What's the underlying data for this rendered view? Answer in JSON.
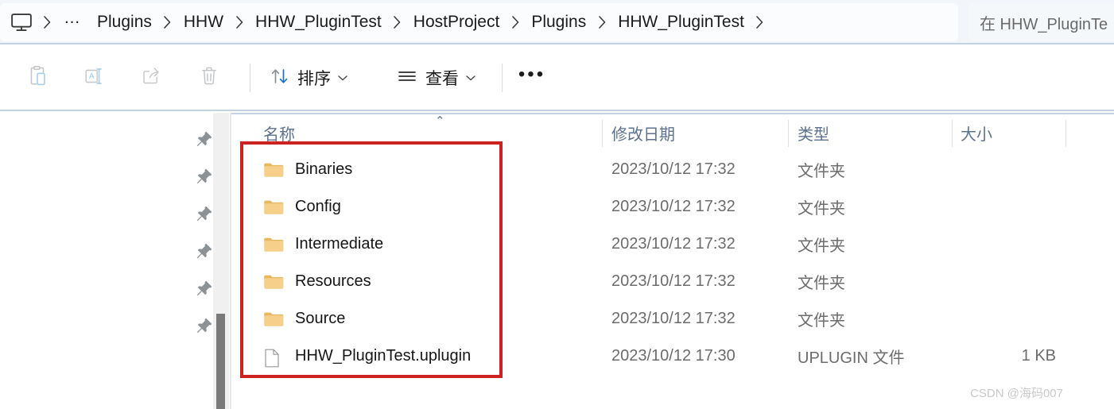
{
  "window": {
    "app": "windows-file-explorer",
    "accent_color": "#0f6cbd",
    "annotation_color": "#cc2222"
  },
  "addressbar": {
    "pc_icon": "monitor-icon",
    "overflow_label": "…",
    "crumbs": [
      "Plugins",
      "HHW",
      "HHW_PluginTest",
      "HostProject",
      "Plugins",
      "HHW_PluginTest"
    ],
    "separator": "›",
    "search": {
      "placeholder": "在 HHW_PluginTe",
      "value": ""
    }
  },
  "toolbar": {
    "icon_buttons": [
      {
        "name": "paste-button",
        "icon": "clipboard-paste-icon",
        "enabled": false
      },
      {
        "name": "rename-button",
        "icon": "rename-icon",
        "enabled": false
      },
      {
        "name": "share-button",
        "icon": "share-icon",
        "enabled": false
      },
      {
        "name": "delete-button",
        "icon": "trash-icon",
        "enabled": false
      }
    ],
    "sort": {
      "label": "排序",
      "icon": "sort-arrows-icon",
      "chevron": "⌄"
    },
    "view": {
      "label": "查看",
      "icon": "view-lines-icon",
      "chevron": "⌄"
    },
    "more": {
      "label": "•••",
      "icon": "more-horizontal-icon"
    }
  },
  "navpane": {
    "pin_icon": "pin-icon",
    "pin_count": 6,
    "scrollbar": "vertical-scrollbar"
  },
  "filelist": {
    "columns": [
      {
        "key": "name",
        "label": "名称",
        "sorted": "asc",
        "sort_caret": "⌃"
      },
      {
        "key": "date",
        "label": "修改日期"
      },
      {
        "key": "type",
        "label": "类型"
      },
      {
        "key": "size",
        "label": "大小"
      }
    ],
    "rows": [
      {
        "name": "Binaries",
        "icon": "folder-icon",
        "date": "2023/10/12 17:32",
        "type": "文件夹",
        "size": ""
      },
      {
        "name": "Config",
        "icon": "folder-icon",
        "date": "2023/10/12 17:32",
        "type": "文件夹",
        "size": ""
      },
      {
        "name": "Intermediate",
        "icon": "folder-icon",
        "date": "2023/10/12 17:32",
        "type": "文件夹",
        "size": ""
      },
      {
        "name": "Resources",
        "icon": "folder-icon",
        "date": "2023/10/12 17:32",
        "type": "文件夹",
        "size": ""
      },
      {
        "name": "Source",
        "icon": "folder-icon",
        "date": "2023/10/12 17:32",
        "type": "文件夹",
        "size": ""
      },
      {
        "name": "HHW_PluginTest.uplugin",
        "icon": "document-icon",
        "date": "2023/10/12 17:30",
        "type": "UPLUGIN 文件",
        "size": "1 KB"
      }
    ]
  },
  "annotation": {
    "name": "red-highlight-box",
    "target": "file-name-column"
  },
  "watermark": {
    "text": "CSDN @海码007"
  }
}
